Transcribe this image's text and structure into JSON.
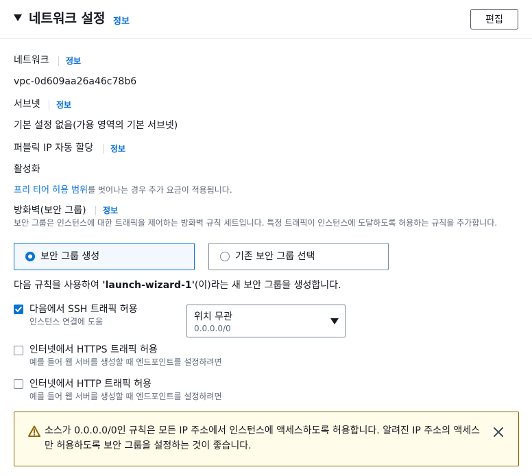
{
  "header": {
    "title": "네트워크 설정",
    "info": "정보",
    "edit_label": "편집"
  },
  "network": {
    "label": "네트워크",
    "info": "정보",
    "value": "vpc-0d609aa26a46c78b6"
  },
  "subnet": {
    "label": "서브넷",
    "info": "정보",
    "value": "기본 설정 없음(가용 영역의 기본 서브넷)"
  },
  "public_ip": {
    "label": "퍼블릭 IP 자동 할당",
    "info": "정보",
    "value": "활성화"
  },
  "free_tier_notice": {
    "link": "프리 티어 허용 범위",
    "text": "를 벗어나는 경우 추가 요금이 적용됩니다."
  },
  "firewall": {
    "label": "방화벽(보안 그룹)",
    "info": "정보",
    "description": "보안 그룹은 인스턴스에 대한 트래픽을 제어하는 방화벽 규칙 세트입니다. 특정 트래픽이 인스턴스에 도달하도록 허용하는 규칙을 추가합니다.",
    "options": [
      {
        "label": "보안 그룹 생성",
        "selected": true
      },
      {
        "label": "기존 보안 그룹 선택",
        "selected": false
      }
    ]
  },
  "rule_text": {
    "prefix": "다음 규칙을 사용하여 ",
    "group_name": "'launch-wizard-1'",
    "suffix": "(이)라는 새 보안 그룹을 생성합니다."
  },
  "rules": [
    {
      "label": "다음에서 SSH 트래픽 허용",
      "sub": "인스턴스 연결에 도움",
      "checked": true
    },
    {
      "label": "인터넷에서 HTTPS 트래픽 허용",
      "sub": "예를 들어 웹 서버를 생성할 때 엔드포인트를 설정하려면",
      "checked": false
    },
    {
      "label": "인터넷에서 HTTP 트래픽 허용",
      "sub": "예를 들어 웹 서버를 생성할 때 엔드포인트를 설정하려면",
      "checked": false
    }
  ],
  "ssh_source": {
    "value": "위치 무관",
    "sub": "0.0.0.0/0"
  },
  "alert": {
    "text": "소스가 0.0.0.0/0인 규칙은 모든 IP 주소에서 인스턴스에 액세스하도록 허용합니다. 알려진 IP 주소의 액세스만 허용하도록 보안 그룹을 설정하는 것이 좋습니다."
  },
  "colors": {
    "link": "#0972d3",
    "warning_border": "#8d6605",
    "warning_bg": "#fffce9"
  }
}
